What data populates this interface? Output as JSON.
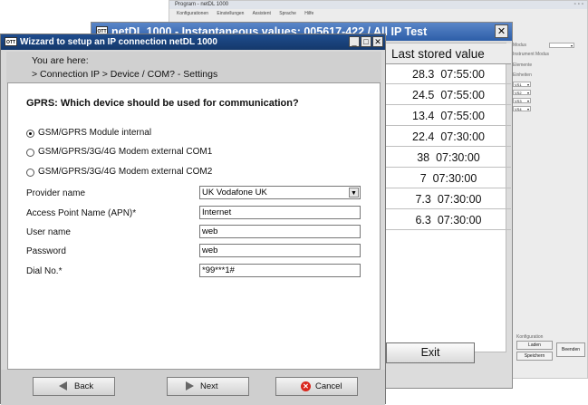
{
  "back_window": {
    "title": "Program - netDL 1000",
    "menu": [
      "Konfigurationen",
      "Einstellungen",
      "Assistent",
      "Sprache",
      "Hilfe"
    ],
    "side": {
      "field1": "Modus",
      "field2": "Instrument Modus",
      "field3": "Elemente",
      "field4": "Einheiten",
      "selects": [
        "VS1",
        "VS2",
        "VS3",
        "VS4"
      ],
      "config_label": "Konfiguration",
      "btn_load": "Laden",
      "btn_save": "Speichern",
      "btn_close": "Beenden"
    }
  },
  "values_window": {
    "title": "netDL 1000 - Instantaneous values: 005617-422 / All IP Test",
    "icon_label": "OTT",
    "close": "✕",
    "column_header": "Last stored value",
    "rows": [
      {
        "value": "28.3",
        "time": "07:55:00"
      },
      {
        "value": "24.5",
        "time": "07:55:00"
      },
      {
        "value": "13.4",
        "time": "07:55:00"
      },
      {
        "value": "22.4",
        "time": "07:30:00"
      },
      {
        "value": "38",
        "time": "07:30:00"
      },
      {
        "value": "7",
        "time": "07:30:00"
      },
      {
        "value": "7.3",
        "time": "07:30:00"
      },
      {
        "value": "6.3",
        "time": "07:30:00"
      }
    ],
    "exit_label": "Exit"
  },
  "wizard": {
    "title": "Wizzard to setup an IP connection  netDL 1000",
    "icon_label": "OTT",
    "controls": {
      "minimize": "_",
      "maximize": "□",
      "close": "✕"
    },
    "you_are_here": "You are here:",
    "breadcrumb": "> Connection IP   > Device / COM? - Settings",
    "question": "GPRS:  Which device should be used for communication?",
    "options": [
      {
        "label": "GSM/GPRS Module internal",
        "selected": true
      },
      {
        "label": "GSM/GPRS/3G/4G Modem external COM1",
        "selected": false
      },
      {
        "label": "GSM/GPRS/3G/4G Modem external COM2",
        "selected": false
      }
    ],
    "fields": {
      "provider": {
        "label": "Provider name",
        "value": "UK Vodafone UK"
      },
      "apn": {
        "label": "Access Point Name (APN)*",
        "value": "Internet"
      },
      "user": {
        "label": "User name",
        "value": "web"
      },
      "password": {
        "label": "Password",
        "value": "web"
      },
      "dial": {
        "label": "Dial No.*",
        "value": "*99***1#"
      }
    },
    "buttons": {
      "back": "Back",
      "next": "Next",
      "cancel": "Cancel"
    }
  }
}
